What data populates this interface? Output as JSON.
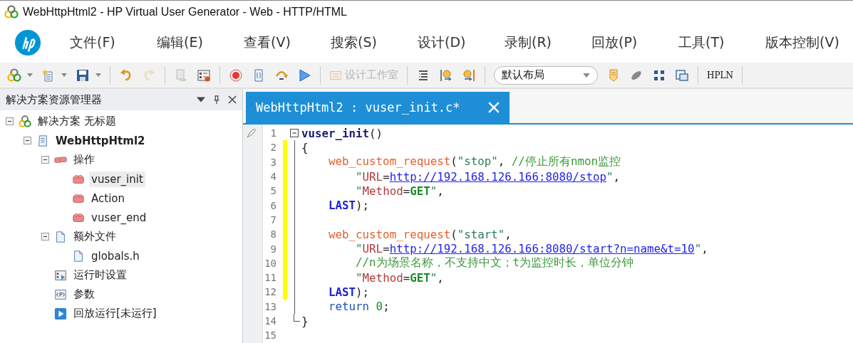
{
  "window": {
    "title": "WebHttpHtml2 - HP Virtual User Generator - Web - HTTP/HTML"
  },
  "menu": [
    {
      "label": "文件(F)"
    },
    {
      "label": "编辑(E)"
    },
    {
      "label": "查看(V)"
    },
    {
      "label": "搜索(S)"
    },
    {
      "label": "设计(D)"
    },
    {
      "label": "录制(R)"
    },
    {
      "label": "回放(P)"
    },
    {
      "label": "工具(T)"
    },
    {
      "label": "版本控制(V)"
    }
  ],
  "toolbar": {
    "design_studio": {
      "label": "设计工作室",
      "disabled": true
    },
    "layout": {
      "value": "默认布局"
    },
    "hpln": {
      "label": "HPLN"
    }
  },
  "solution_explorer": {
    "title": "解决方案资源管理器",
    "tree": [
      {
        "kind": "solution",
        "label": "解决方案 无标题",
        "expanded": true,
        "selected": false,
        "children": [
          {
            "kind": "script",
            "label": "WebHttpHtml2",
            "expanded": true,
            "selected": false,
            "children": [
              {
                "kind": "actions",
                "label": "操作",
                "expanded": true,
                "selected": false,
                "children": [
                  {
                    "kind": "action",
                    "label": "vuser_init",
                    "selected": true
                  },
                  {
                    "kind": "action",
                    "label": "Action",
                    "selected": false
                  },
                  {
                    "kind": "action",
                    "label": "vuser_end",
                    "selected": false
                  }
                ]
              },
              {
                "kind": "folder",
                "label": "额外文件",
                "expanded": true,
                "selected": false,
                "children": [
                  {
                    "kind": "file",
                    "label": "globals.h",
                    "selected": false
                  }
                ]
              },
              {
                "kind": "settings",
                "label": "运行时设置",
                "selected": false
              },
              {
                "kind": "params",
                "label": "参数",
                "selected": false
              },
              {
                "kind": "replay",
                "label": "回放运行[未运行]",
                "selected": false
              }
            ]
          }
        ]
      }
    ]
  },
  "editor": {
    "tab": {
      "label": "WebHttpHtml2 : vuser_init.c*",
      "selected": true
    },
    "lines": [
      {
        "number": "1",
        "kind": "head",
        "changed": false,
        "tokens": [
          {
            "kind": "name",
            "text": "vuser_init"
          },
          {
            "kind": "plain",
            "text": "()"
          }
        ]
      },
      {
        "number": "2",
        "kind": "open",
        "changed": true,
        "tokens": [
          {
            "kind": "plain",
            "text": "{"
          }
        ]
      },
      {
        "number": "3",
        "kind": "stmt",
        "changed": true,
        "tokens": [
          {
            "kind": "fn",
            "text": "web_custom_request"
          },
          {
            "kind": "plain",
            "text": "("
          },
          {
            "kind": "str",
            "text": "\"stop\""
          },
          {
            "kind": "plain",
            "text": ", "
          },
          {
            "kind": "cmt",
            "text": "//停止所有nmon监控"
          }
        ]
      },
      {
        "number": "4",
        "kind": "arg",
        "changed": true,
        "tokens": [
          {
            "kind": "str",
            "text": "\""
          },
          {
            "kind": "attr",
            "text": "URL"
          },
          {
            "kind": "plain",
            "text": "="
          },
          {
            "kind": "url",
            "text": "http://192.168.126.166:8080/stop"
          },
          {
            "kind": "str",
            "text": "\""
          },
          {
            "kind": "plain",
            "text": ","
          }
        ]
      },
      {
        "number": "5",
        "kind": "arg",
        "changed": true,
        "tokens": [
          {
            "kind": "str",
            "text": "\""
          },
          {
            "kind": "attr",
            "text": "Method"
          },
          {
            "kind": "plain",
            "text": "="
          },
          {
            "kind": "val",
            "text": "GET"
          },
          {
            "kind": "str",
            "text": "\""
          },
          {
            "kind": "plain",
            "text": ","
          }
        ]
      },
      {
        "number": "6",
        "kind": "stmt",
        "changed": true,
        "tokens": [
          {
            "kind": "kw",
            "text": "LAST"
          },
          {
            "kind": "plain",
            "text": ");"
          }
        ]
      },
      {
        "number": "7",
        "kind": "blank",
        "changed": true
      },
      {
        "number": "8",
        "kind": "stmt",
        "changed": true,
        "tokens": [
          {
            "kind": "fn",
            "text": "web_custom_request"
          },
          {
            "kind": "plain",
            "text": "("
          },
          {
            "kind": "str",
            "text": "\"start\""
          },
          {
            "kind": "plain",
            "text": ","
          }
        ]
      },
      {
        "number": "9",
        "kind": "arg",
        "changed": true,
        "tokens": [
          {
            "kind": "str",
            "text": "\""
          },
          {
            "kind": "attr",
            "text": "URL"
          },
          {
            "kind": "plain",
            "text": "="
          },
          {
            "kind": "url",
            "text": "http://192.168.126.166:8080/start?n=name&t=10"
          },
          {
            "kind": "str",
            "text": "\""
          },
          {
            "kind": "plain",
            "text": ","
          }
        ]
      },
      {
        "number": "10",
        "kind": "arg",
        "changed": true,
        "tokens": [
          {
            "kind": "cmt",
            "text": "//n为场景名称，不支持中文；t为监控时长，单位分钟"
          }
        ]
      },
      {
        "number": "11",
        "kind": "arg",
        "changed": true,
        "tokens": [
          {
            "kind": "str",
            "text": "\""
          },
          {
            "kind": "attr",
            "text": "Method"
          },
          {
            "kind": "plain",
            "text": "="
          },
          {
            "kind": "val",
            "text": "GET"
          },
          {
            "kind": "str",
            "text": "\""
          },
          {
            "kind": "plain",
            "text": ","
          }
        ]
      },
      {
        "number": "12",
        "kind": "stmt",
        "changed": true,
        "tokens": [
          {
            "kind": "kw",
            "text": "LAST"
          },
          {
            "kind": "plain",
            "text": ");"
          }
        ]
      },
      {
        "number": "13",
        "kind": "stmt",
        "changed": false,
        "tokens": [
          {
            "kind": "ret",
            "text": "return"
          },
          {
            "kind": "num",
            "text": "0"
          },
          {
            "kind": "plain",
            "text": ";"
          }
        ]
      },
      {
        "number": "14",
        "kind": "close",
        "changed": false,
        "tokens": [
          {
            "kind": "plain",
            "text": "}"
          }
        ]
      },
      {
        "number": "15",
        "kind": "blank",
        "changed": false
      }
    ]
  }
}
